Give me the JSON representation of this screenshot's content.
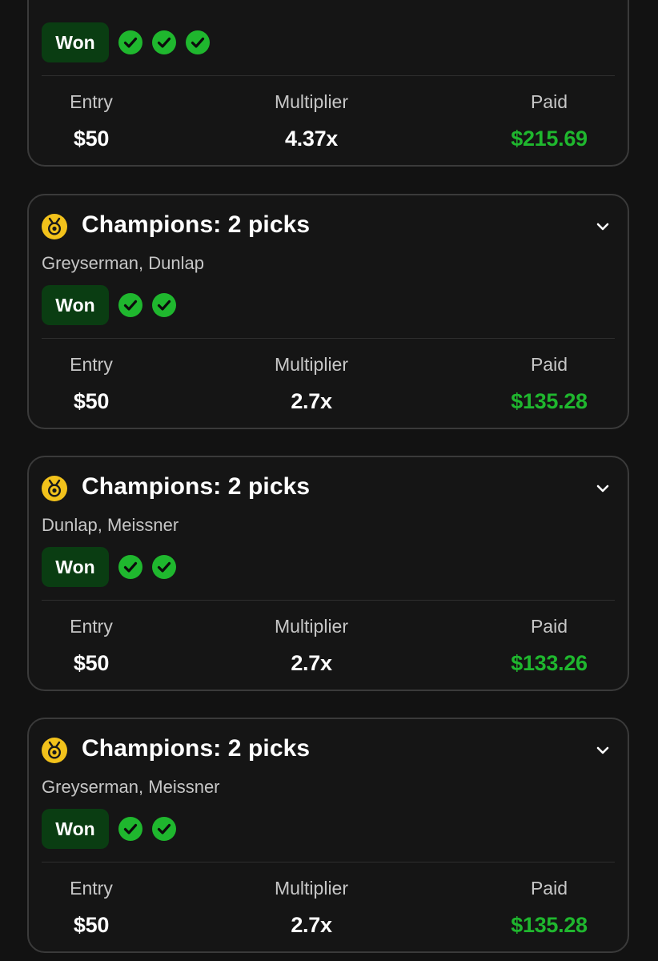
{
  "colors": {
    "background": "#121212",
    "card_border": "#3a3a3a",
    "won_badge_bg": "#0a3d12",
    "check_green": "#1fb72e",
    "paid_green": "#1fb72e",
    "medal_gold": "#f2c21b"
  },
  "labels": {
    "entry": "Entry",
    "multiplier": "Multiplier",
    "paid": "Paid"
  },
  "cards": [
    {
      "title": "",
      "players": "",
      "status": "Won",
      "checks": 3,
      "entry": "$50",
      "multiplier": "4.37x",
      "paid": "$215.69"
    },
    {
      "title": "Champions: 2 picks",
      "players": "Greyserman, Dunlap",
      "status": "Won",
      "checks": 2,
      "entry": "$50",
      "multiplier": "2.7x",
      "paid": "$135.28"
    },
    {
      "title": "Champions: 2 picks",
      "players": "Dunlap, Meissner",
      "status": "Won",
      "checks": 2,
      "entry": "$50",
      "multiplier": "2.7x",
      "paid": "$133.26"
    },
    {
      "title": "Champions: 2 picks",
      "players": "Greyserman, Meissner",
      "status": "Won",
      "checks": 2,
      "entry": "$50",
      "multiplier": "2.7x",
      "paid": "$135.28"
    }
  ],
  "icons": {
    "medal": "medal-icon",
    "chevron": "chevron-down-icon",
    "check": "check-circle-icon"
  }
}
